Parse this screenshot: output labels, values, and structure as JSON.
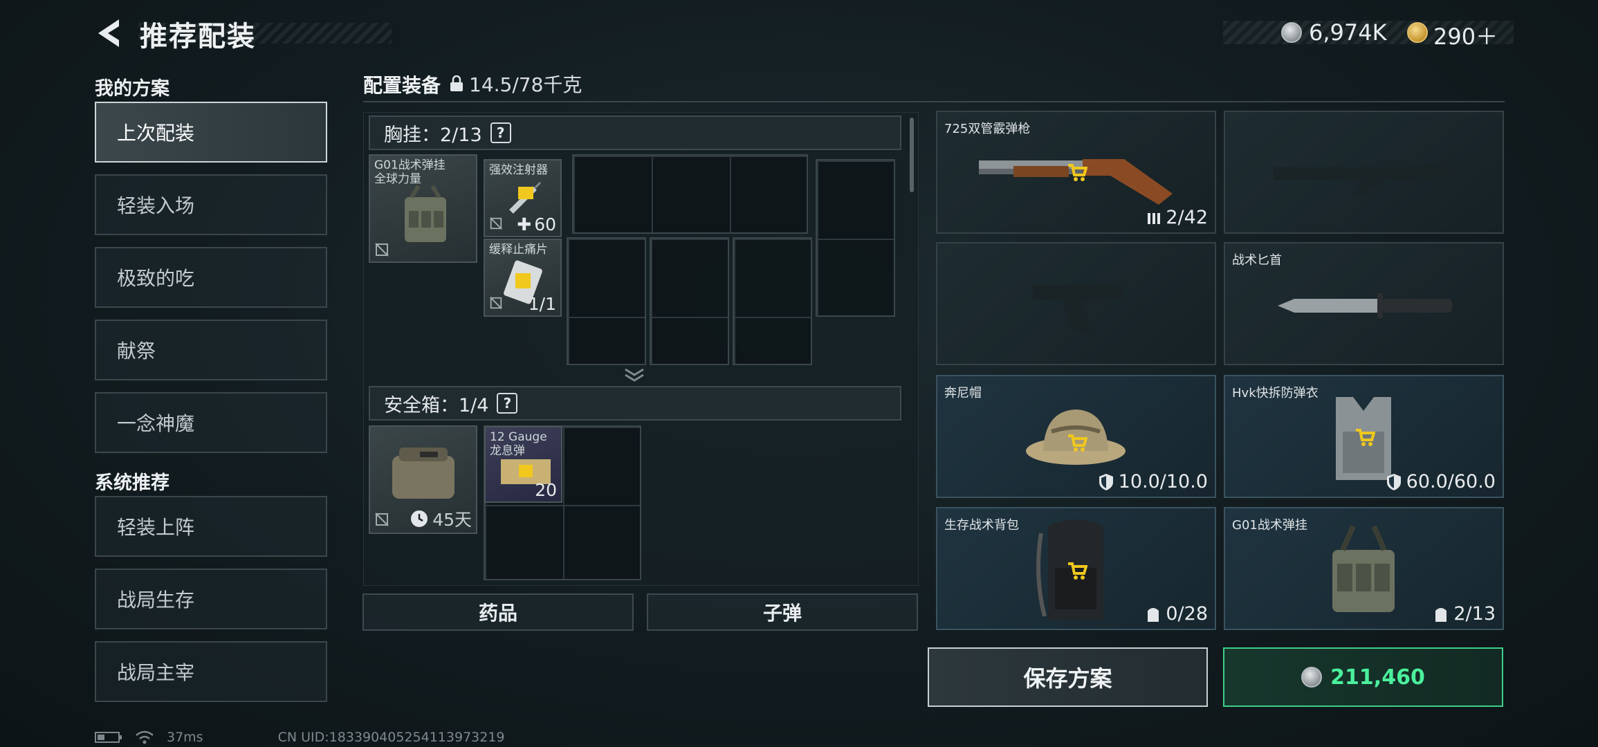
{
  "header": {
    "title": "推荐配装",
    "currency_silver": "6,974K",
    "currency_gold": "290＋"
  },
  "left": {
    "my_plans_label": "我的方案",
    "my_plans": [
      "上次配装",
      "轻装入场",
      "极致的吃",
      "献祭",
      "一念神魔"
    ],
    "system_label": "系统推荐",
    "system_plans": [
      "轻装上阵",
      "战局生存",
      "战局主宰"
    ]
  },
  "center": {
    "title": "配置装备",
    "weight": "14.5/78千克",
    "chest_rig": {
      "label": "胸挂：2/13",
      "container_name": "G01战术弹挂\n全球力量",
      "items": [
        {
          "name": "强效注射器",
          "count": "60"
        },
        {
          "name": "缓释止痛片",
          "count": "1/1"
        }
      ]
    },
    "safe_box": {
      "label": "安全箱：1/4",
      "timer": "45天",
      "items": [
        {
          "name": "12 Gauge\n龙息弹",
          "count": "20"
        }
      ]
    },
    "buttons": {
      "meds": "药品",
      "ammo": "子弹"
    }
  },
  "equipment": [
    {
      "name": "725双管霰弹枪",
      "stat": "2/42",
      "style": "normal"
    },
    {
      "name": "",
      "stat": "",
      "style": "empty"
    },
    {
      "name": "",
      "stat": "",
      "style": "empty"
    },
    {
      "name": "战术匕首",
      "stat": "",
      "style": "normal"
    },
    {
      "name": "奔尼帽",
      "stat": "10.0/10.0",
      "style": "blue"
    },
    {
      "name": "Hvk快拆防弹衣",
      "stat": "60.0/60.0",
      "style": "blue"
    },
    {
      "name": "生存战术背包",
      "stat": "0/28",
      "style": "blue"
    },
    {
      "name": "G01战术弹挂",
      "stat": "2/13",
      "style": "blue"
    }
  ],
  "actions": {
    "save": "保存方案",
    "price": "211,460"
  },
  "footer": {
    "ping": "37ms",
    "uid": "CN UID:1833904052541139732​19"
  },
  "colors": {
    "accent_green": "#4bf09c",
    "cart_yellow": "#f0c81e"
  }
}
